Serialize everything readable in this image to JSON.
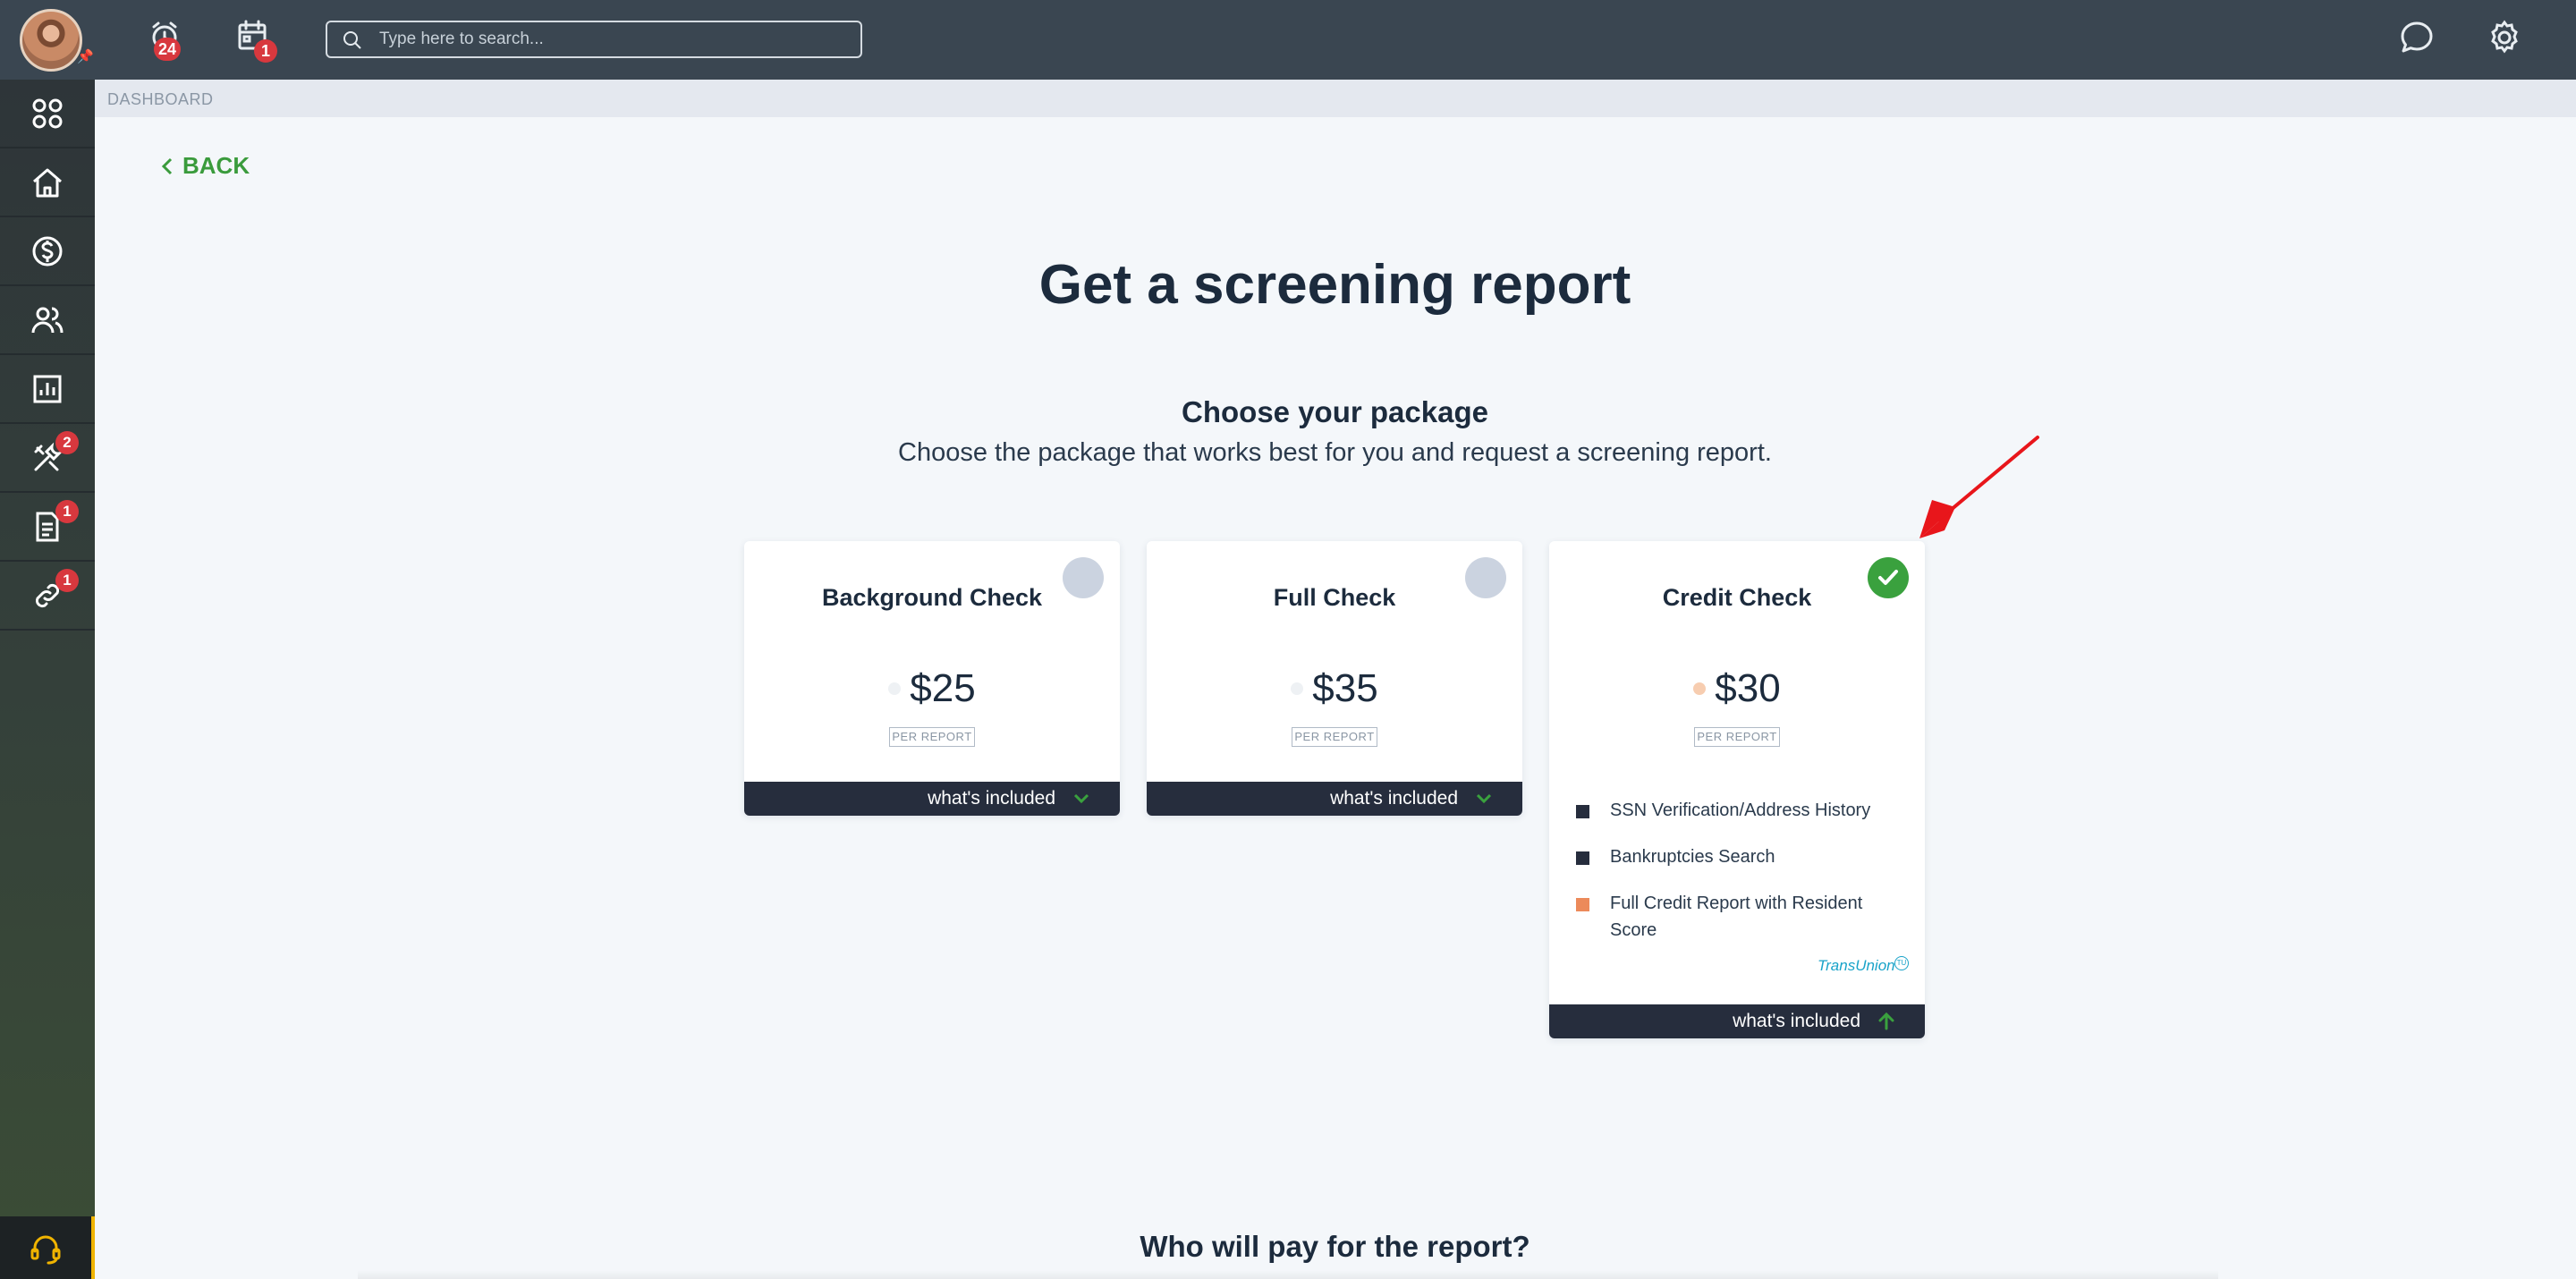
{
  "topbar": {
    "alerts_badge": "24",
    "calendar_badge": "1",
    "search_placeholder": "Type here to search..."
  },
  "sidebar": {
    "items": [
      {
        "icon": "apps-icon",
        "badge": ""
      },
      {
        "icon": "home-icon",
        "badge": ""
      },
      {
        "icon": "dollar-icon",
        "badge": ""
      },
      {
        "icon": "people-icon",
        "badge": ""
      },
      {
        "icon": "chart-icon",
        "badge": ""
      },
      {
        "icon": "tools-icon",
        "badge": "2"
      },
      {
        "icon": "document-icon",
        "badge": "1"
      },
      {
        "icon": "link-icon",
        "badge": "1"
      }
    ]
  },
  "breadcrumb": "DASHBOARD",
  "back_label": "BACK",
  "page_title": "Get a screening report",
  "section_title": "Choose your package",
  "section_desc": "Choose the package that works best for you and request a screening report.",
  "packages": [
    {
      "title": "Background Check",
      "price": "$25",
      "per": "PER REPORT",
      "footer": "what's included",
      "selected": false
    },
    {
      "title": "Full Check",
      "price": "$35",
      "per": "PER REPORT",
      "footer": "what's included",
      "selected": false
    },
    {
      "title": "Credit Check",
      "price": "$30",
      "per": "PER REPORT",
      "footer": "what's included",
      "selected": true,
      "features": [
        "SSN Verification/Address History",
        "Bankruptcies Search",
        "Full Credit Report with Resident Score"
      ],
      "brand": "TransUnion",
      "brand_mark": "TU"
    }
  ],
  "next_section_title": "Who will pay for the report?",
  "colors": {
    "accent_green": "#3a9b3c",
    "badge_red": "#d8383e",
    "topbar": "#3a4651",
    "annotation_arrow": "#e8161b"
  }
}
